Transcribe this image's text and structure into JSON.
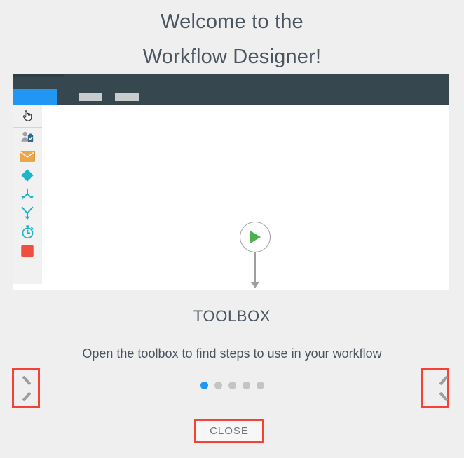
{
  "dialog": {
    "title_line1": "Welcome to the",
    "title_line2": "Workflow Designer!",
    "caption_heading": "TOOLBOX",
    "caption_text": "Open the toolbox to find steps to use in your workflow",
    "close_label": "CLOSE"
  },
  "colors": {
    "page_background": "#efeff0",
    "title_text": "#4a5560",
    "app_bar": "#37474f",
    "accent_blue": "#2196f3",
    "highlight_red": "#f44336",
    "dot_inactive": "#c4c4c4",
    "teal_icon": "#1cb5c9",
    "orange_icon": "#eca74a",
    "red_icon": "#ef4e42",
    "green_play": "#4caf50",
    "node_outline": "#9e9e9e",
    "placeholder_dash": "#c9c9c9",
    "tool_strip": "#f1f1f1"
  },
  "illustration": {
    "app_bar": {
      "active_tab_label": "",
      "placeholder_tabs": [
        "",
        ""
      ]
    },
    "toolbox_items": [
      {
        "icon": "hand-pointer-icon",
        "name": "select-tool"
      },
      {
        "icon": "user-task-icon",
        "name": "user-task-step"
      },
      {
        "icon": "envelope-icon",
        "name": "email-step"
      },
      {
        "icon": "diamond-decision-icon",
        "name": "decision-step"
      },
      {
        "icon": "merge-arrows-icon",
        "name": "merge-step"
      },
      {
        "icon": "fork-arrow-icon",
        "name": "fork-step"
      },
      {
        "icon": "stopwatch-icon",
        "name": "timer-step"
      },
      {
        "icon": "stop-square-icon",
        "name": "stop-step"
      }
    ],
    "canvas": {
      "start_node_icon": "play-triangle-icon",
      "connector_icon": "arrow-down-icon",
      "placeholder_node_icon": "dashed-placeholder-icon"
    }
  },
  "pagination": {
    "total": 5,
    "active_index": 0,
    "prev_icon": "chevron-left-icon",
    "next_icon": "chevron-right-icon"
  }
}
